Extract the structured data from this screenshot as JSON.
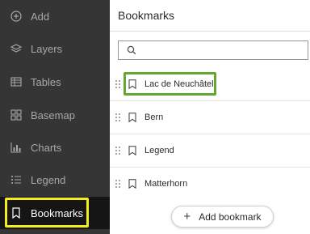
{
  "sidebar": {
    "items": [
      {
        "label": "Add",
        "icon": "plus-circle-icon"
      },
      {
        "label": "Layers",
        "icon": "layers-icon"
      },
      {
        "label": "Tables",
        "icon": "table-icon"
      },
      {
        "label": "Basemap",
        "icon": "basemap-grid-icon"
      },
      {
        "label": "Charts",
        "icon": "bar-chart-icon"
      },
      {
        "label": "Legend",
        "icon": "legend-list-icon"
      },
      {
        "label": "Bookmarks",
        "icon": "bookmark-icon",
        "active": true
      }
    ]
  },
  "panel": {
    "title": "Bookmarks",
    "search": {
      "placeholder": "",
      "value": ""
    },
    "bookmarks": [
      {
        "label": "Lac de Neuchâtel"
      },
      {
        "label": "Bern"
      },
      {
        "label": "Legend"
      },
      {
        "label": "Matterhorn"
      }
    ],
    "add_button": {
      "label": "Add bookmark",
      "icon": "plus-icon"
    }
  },
  "colors": {
    "sidebar_bg": "#353535",
    "sidebar_active_bg": "#151515",
    "highlight_yellow": "#f5ee1e",
    "highlight_green": "#5fa832"
  }
}
